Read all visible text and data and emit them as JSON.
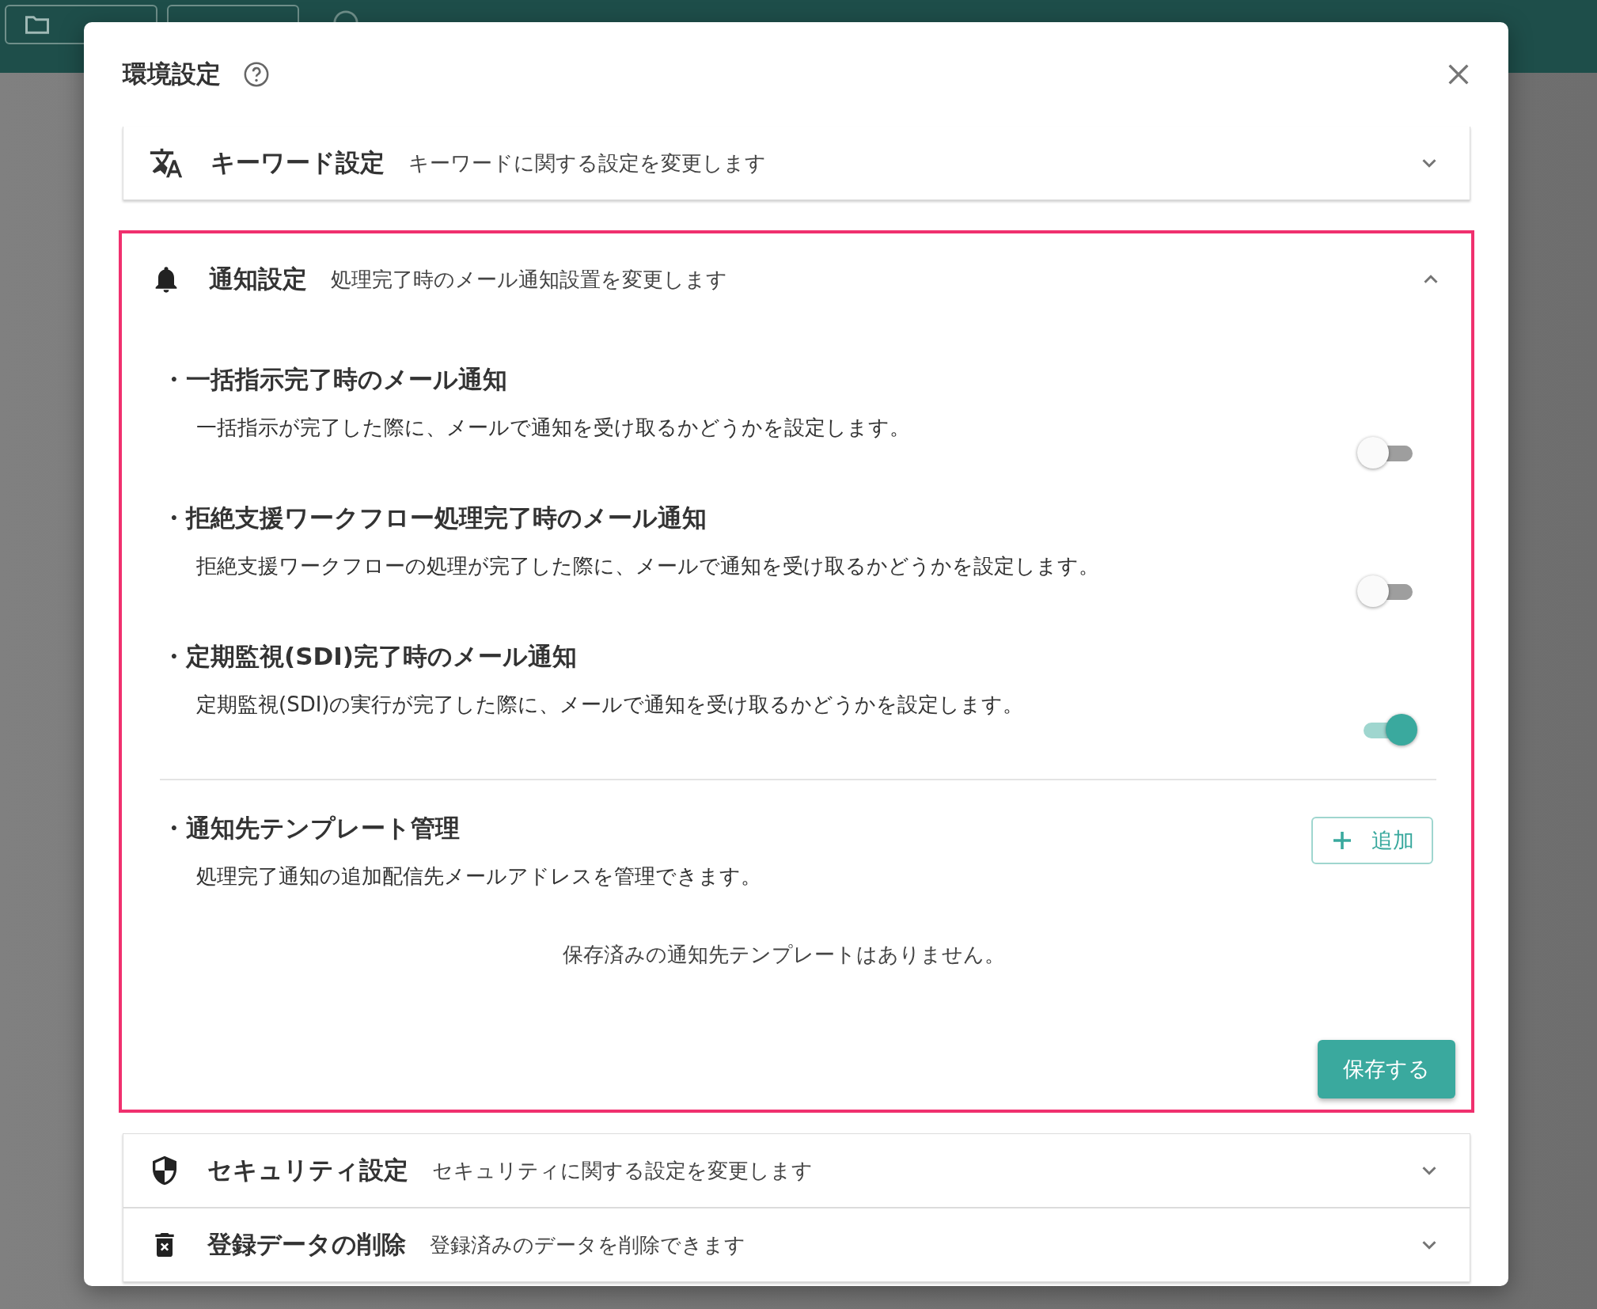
{
  "dialog": {
    "title": "環境設定",
    "sections": [
      {
        "title": "キーワード設定",
        "description": "キーワードに関する設定を変更します",
        "expanded": false,
        "highlighted": false
      },
      {
        "title": "通知設定",
        "description": "処理完了時のメール通知設置を変更します",
        "expanded": true,
        "highlighted": true,
        "settings": [
          {
            "title": "・一括指示完了時のメール通知",
            "description": "一括指示が完了した際に、メールで通知を受け取るかどうかを設定します。",
            "on": false
          },
          {
            "title": "・拒絶支援ワークフロー処理完了時のメール通知",
            "description": "拒絶支援ワークフローの処理が完了した際に、メールで通知を受け取るかどうかを設定します。",
            "on": false
          },
          {
            "title": "・定期監視(SDI)完了時のメール通知",
            "description": "定期監視(SDI)の実行が完了した際に、メールで通知を受け取るかどうかを設定します。",
            "on": true
          }
        ],
        "templates": {
          "title": "・通知先テンプレート管理",
          "description": "処理完了通知の追加配信先メールアドレスを管理できます。",
          "add_button": "追加",
          "empty_message": "保存済みの通知先テンプレートはありません。"
        },
        "save_button": "保存する"
      },
      {
        "title": "セキュリティ設定",
        "description": "セキュリティに関する設定を変更します",
        "expanded": false,
        "highlighted": false
      },
      {
        "title": "登録データの削除",
        "description": "登録済みのデータを削除できます",
        "expanded": false,
        "highlighted": false
      }
    ]
  }
}
